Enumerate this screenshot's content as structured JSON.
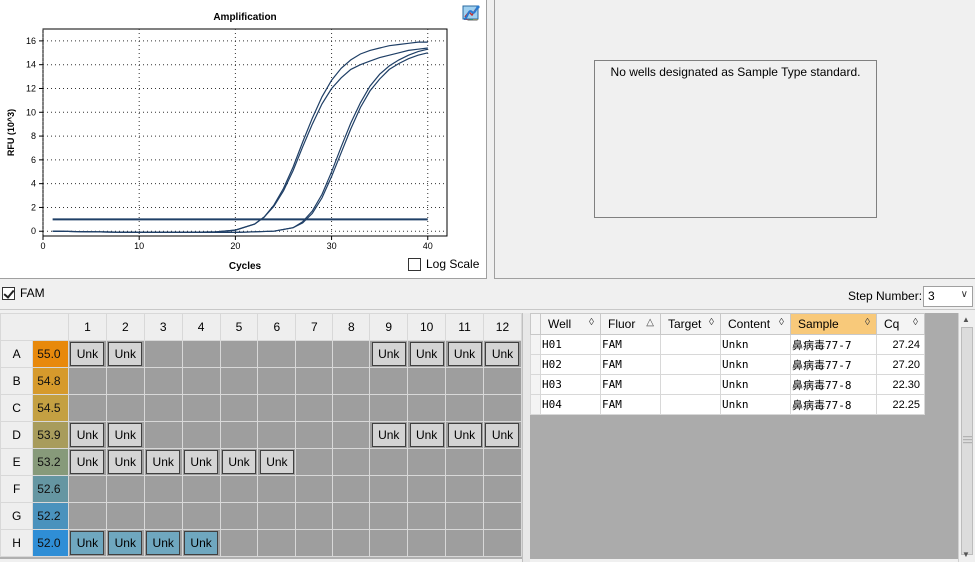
{
  "chart_data": {
    "type": "line",
    "title": "Amplification",
    "xlabel": "Cycles",
    "ylabel": "RFU (10^3)",
    "xlim": [
      0,
      42
    ],
    "ylim": [
      -0.4,
      17
    ],
    "xticks": [
      0,
      10,
      20,
      30,
      40
    ],
    "yticks": [
      0,
      2,
      4,
      6,
      8,
      10,
      12,
      14,
      16
    ],
    "grid": true,
    "threshold": 1.0,
    "series": [
      {
        "x": [
          1,
          5,
          10,
          15,
          18,
          20,
          22,
          23,
          24,
          25,
          26,
          27,
          28,
          29,
          30,
          31,
          32,
          33,
          34,
          35,
          36,
          37,
          38,
          39,
          40
        ],
        "values": [
          0.0,
          -0.05,
          -0.1,
          -0.1,
          -0.05,
          0.1,
          0.6,
          1.2,
          2.2,
          3.6,
          5.4,
          7.5,
          9.5,
          11.3,
          12.7,
          13.7,
          14.4,
          14.9,
          15.2,
          15.4,
          15.6,
          15.7,
          15.8,
          15.9,
          15.9
        ]
      },
      {
        "x": [
          1,
          5,
          10,
          15,
          18,
          20,
          22,
          23,
          24,
          25,
          26,
          27,
          28,
          29,
          30,
          31,
          32,
          33,
          34,
          35,
          36,
          37,
          38,
          39,
          40
        ],
        "values": [
          0.0,
          -0.05,
          -0.1,
          -0.1,
          -0.05,
          0.1,
          0.6,
          1.2,
          2.1,
          3.4,
          5.1,
          7.1,
          9.0,
          10.7,
          12.0,
          12.9,
          13.6,
          14.0,
          14.3,
          14.6,
          14.8,
          15.0,
          15.2,
          15.3,
          15.4
        ]
      },
      {
        "x": [
          1,
          5,
          10,
          15,
          20,
          24,
          26,
          27,
          28,
          29,
          30,
          31,
          32,
          33,
          34,
          35,
          36,
          37,
          38,
          39,
          40
        ],
        "values": [
          0.0,
          -0.05,
          -0.1,
          -0.1,
          -0.1,
          0.0,
          0.3,
          0.8,
          1.7,
          3.1,
          5.0,
          7.1,
          9.1,
          10.8,
          12.2,
          13.2,
          13.9,
          14.4,
          14.8,
          15.1,
          15.3
        ]
      },
      {
        "x": [
          1,
          5,
          10,
          15,
          20,
          24,
          26,
          27,
          28,
          29,
          30,
          31,
          32,
          33,
          34,
          35,
          36,
          37,
          38,
          39,
          40
        ],
        "values": [
          0.0,
          -0.05,
          -0.1,
          -0.1,
          -0.1,
          0.0,
          0.3,
          0.7,
          1.5,
          2.8,
          4.6,
          6.6,
          8.6,
          10.4,
          11.8,
          12.8,
          13.6,
          14.1,
          14.5,
          14.8,
          15.0
        ]
      }
    ]
  },
  "chart_options": {
    "log_scale_label": "Log Scale",
    "line_color": "#1f3f66"
  },
  "toolbar_icons": [
    "copy-icon",
    "export-icon",
    "refresh-icon",
    "zoom-icon",
    "curve-icon"
  ],
  "standard_curve": {
    "message": "No wells designated as Sample Type standard."
  },
  "fluor_bar": {
    "fluor_label": "FAM",
    "step_label": "Step Number:",
    "step_value": "3"
  },
  "plate": {
    "columns": [
      "1",
      "2",
      "3",
      "4",
      "5",
      "6",
      "7",
      "8",
      "9",
      "10",
      "11",
      "12"
    ],
    "rows": [
      {
        "label": "A",
        "temp": "55.0",
        "color": "#e8890c",
        "wells": [
          "Unk",
          "Unk",
          "",
          "",
          "",
          "",
          "",
          "",
          "Unk",
          "Unk",
          "Unk",
          "Unk"
        ],
        "tint": ""
      },
      {
        "label": "B",
        "temp": "54.8",
        "color": "#d69a2c",
        "wells": [
          "",
          "",
          "",
          "",
          "",
          "",
          "",
          "",
          "",
          "",
          "",
          ""
        ],
        "tint": ""
      },
      {
        "label": "C",
        "temp": "54.5",
        "color": "#c4a042",
        "wells": [
          "",
          "",
          "",
          "",
          "",
          "",
          "",
          "",
          "",
          "",
          "",
          ""
        ],
        "tint": ""
      },
      {
        "label": "D",
        "temp": "53.9",
        "color": "#a89c5c",
        "wells": [
          "Unk",
          "Unk",
          "",
          "",
          "",
          "",
          "",
          "",
          "Unk",
          "Unk",
          "Unk",
          "Unk"
        ],
        "tint": ""
      },
      {
        "label": "E",
        "temp": "53.2",
        "color": "#879a7a",
        "wells": [
          "Unk",
          "Unk",
          "Unk",
          "Unk",
          "Unk",
          "Unk",
          "",
          "",
          "",
          "",
          "",
          ""
        ],
        "tint": ""
      },
      {
        "label": "F",
        "temp": "52.6",
        "color": "#6596a2",
        "wells": [
          "",
          "",
          "",
          "",
          "",
          "",
          "",
          "",
          "",
          "",
          "",
          ""
        ],
        "tint": ""
      },
      {
        "label": "G",
        "temp": "52.2",
        "color": "#4a92bd",
        "wells": [
          "",
          "",
          "",
          "",
          "",
          "",
          "",
          "",
          "",
          "",
          "",
          ""
        ],
        "tint": ""
      },
      {
        "label": "H",
        "temp": "52.0",
        "color": "#2f8ed6",
        "wells": [
          "Unk",
          "Unk",
          "Unk",
          "Unk",
          "",
          "",
          "",
          "",
          "",
          "",
          "",
          ""
        ],
        "tint": "blue"
      }
    ]
  },
  "results_table": {
    "headers": [
      "Well",
      "Fluor",
      "Target",
      "Content",
      "Sample",
      "Cq"
    ],
    "sort_marks": [
      "◊",
      "△",
      "◊",
      "◊",
      "◊",
      "◊"
    ],
    "selected_col": "Sample",
    "rows": [
      [
        "H01",
        "FAM",
        "",
        "Unkn",
        "鼻病毒77-7",
        "27.24"
      ],
      [
        "H02",
        "FAM",
        "",
        "Unkn",
        "鼻病毒77-7",
        "27.20"
      ],
      [
        "H03",
        "FAM",
        "",
        "Unkn",
        "鼻病毒77-8",
        "22.30"
      ],
      [
        "H04",
        "FAM",
        "",
        "Unkn",
        "鼻病毒77-8",
        "22.25"
      ]
    ]
  }
}
